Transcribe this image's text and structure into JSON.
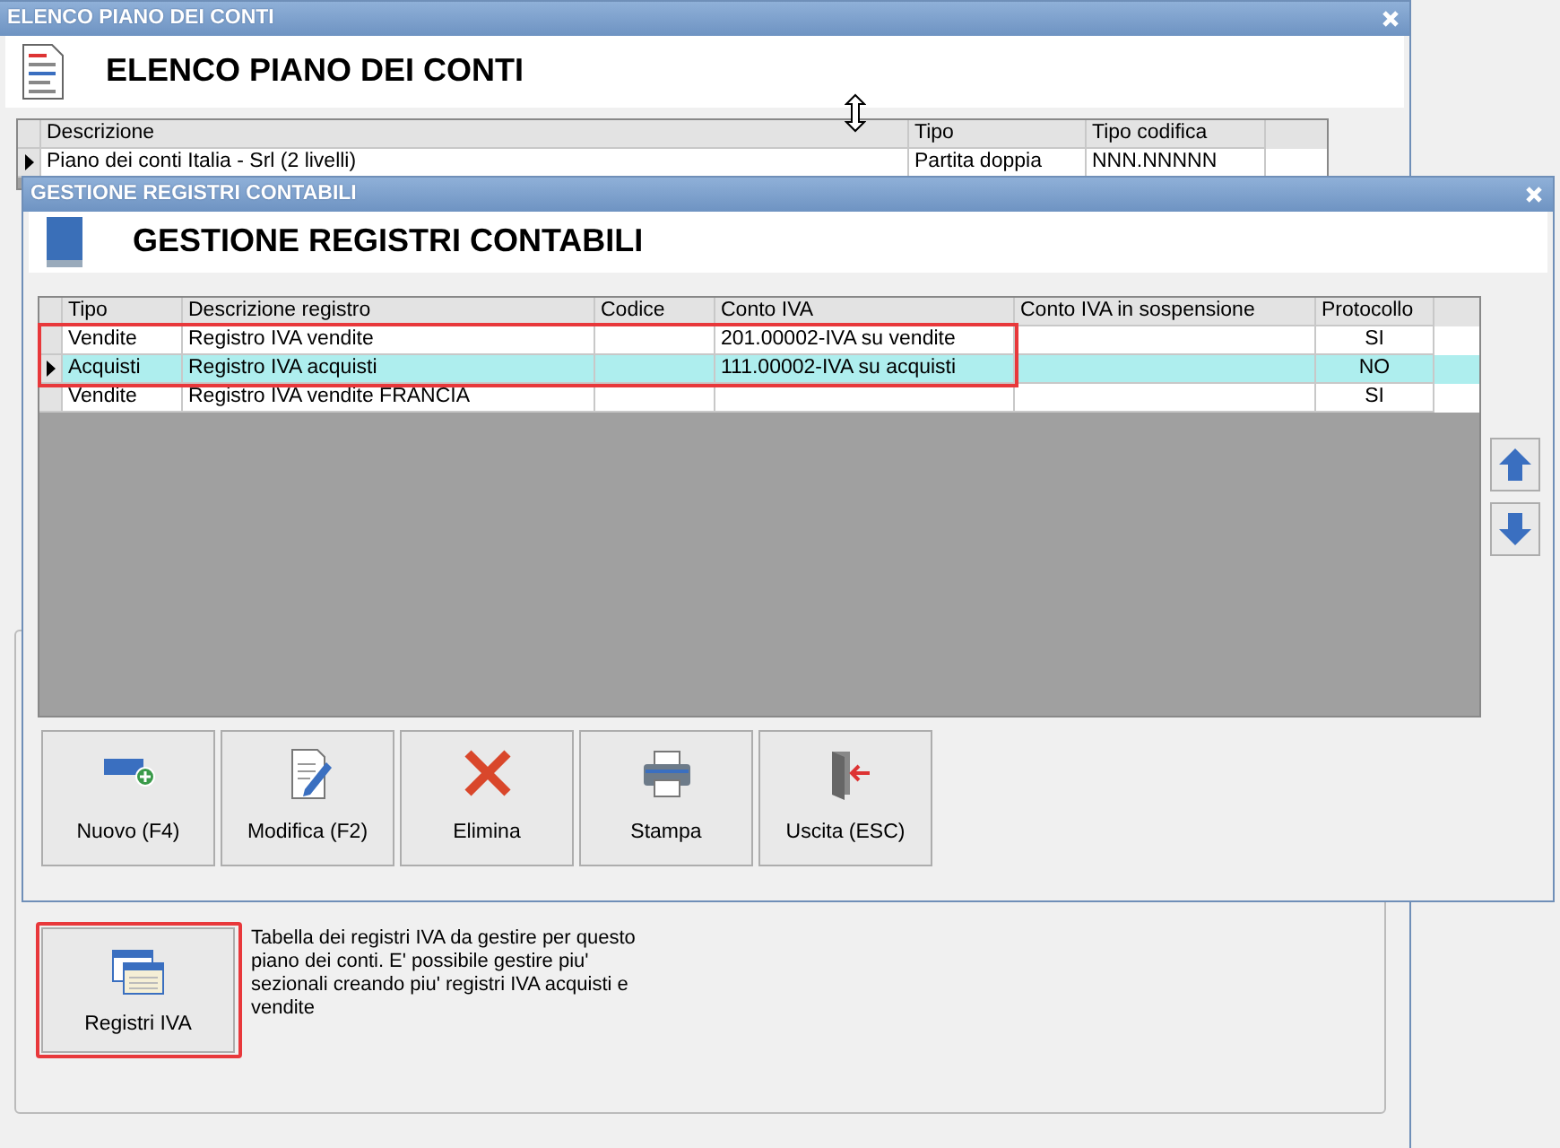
{
  "back_window": {
    "title": "ELENCO PIANO DEI CONTI",
    "header": "ELENCO PIANO DEI CONTI",
    "table": {
      "columns": [
        "Descrizione",
        "Tipo",
        "Tipo codifica"
      ],
      "rows": [
        {
          "cells": [
            "Piano dei conti Italia - Srl (2 livelli)",
            "Partita doppia",
            "NNN.NNNNN"
          ],
          "selected": true
        }
      ]
    },
    "registri_button": {
      "label": "Registri IVA",
      "highlighted": true
    },
    "description": "Tabella dei registri IVA da gestire per questo piano dei conti. E' possibile gestire piu' sezionali creando piu' registri IVA acquisti e vendite"
  },
  "dialog": {
    "title": "GESTIONE REGISTRI CONTABILI",
    "header": "GESTIONE REGISTRI CONTABILI",
    "table": {
      "columns": [
        "Tipo",
        "Descrizione registro",
        "Codice",
        "Conto IVA",
        "Conto IVA in sospensione",
        "Protocollo"
      ],
      "rows": [
        {
          "cells": [
            "Vendite",
            "Registro IVA vendite",
            "",
            "201.00002-IVA su vendite",
            "",
            "SI"
          ],
          "selected": false,
          "highlighted": true
        },
        {
          "cells": [
            "Acquisti",
            "Registro IVA acquisti",
            "",
            "111.00002-IVA su acquisti",
            "",
            "NO"
          ],
          "selected": true,
          "highlighted": true
        },
        {
          "cells": [
            "Vendite",
            "Registro IVA vendite FRANCIA",
            "",
            "",
            "",
            "SI"
          ],
          "selected": false,
          "highlighted": false
        }
      ]
    },
    "toolbar": [
      {
        "label": "Nuovo (F4)",
        "kind": "new"
      },
      {
        "label": "Modifica (F2)",
        "kind": "edit"
      },
      {
        "label": "Elimina",
        "kind": "delete"
      },
      {
        "label": "Stampa",
        "kind": "print"
      },
      {
        "label": "Uscita (ESC)",
        "kind": "exit"
      }
    ]
  }
}
